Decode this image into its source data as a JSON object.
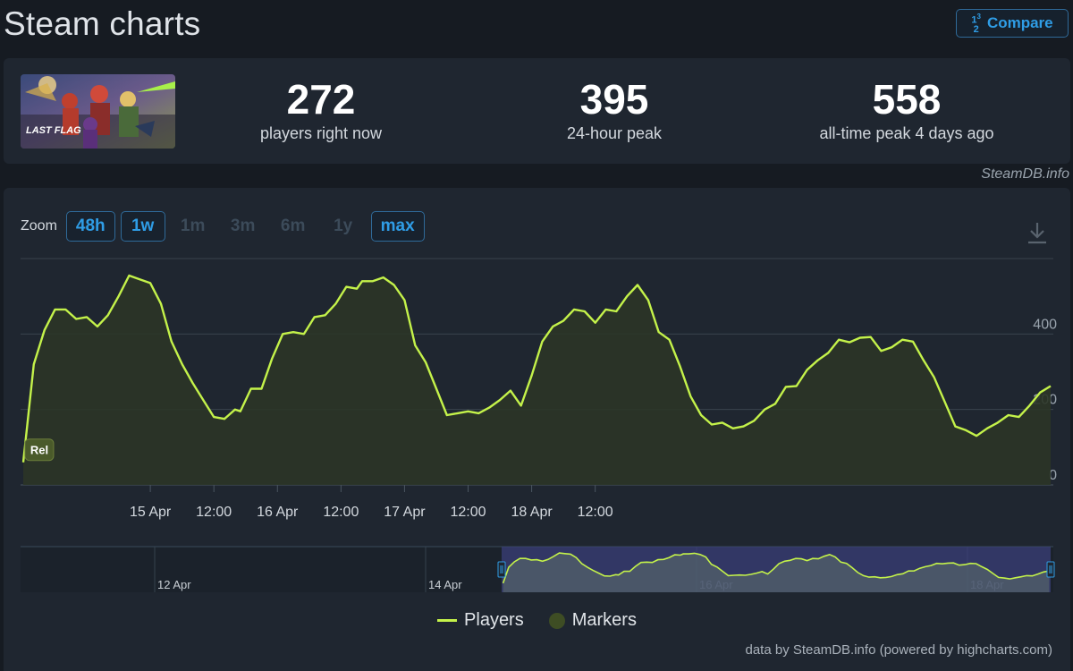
{
  "header": {
    "title": "Steam charts",
    "compare_label": "Compare",
    "compare_icon": "1/2 3"
  },
  "game": {
    "logo_text": "LAST FLAG"
  },
  "stats": [
    {
      "value": "272",
      "label": "players right now"
    },
    {
      "value": "395",
      "label": "24-hour peak"
    },
    {
      "value": "558",
      "label": "all-time peak 4 days ago"
    }
  ],
  "source": "SteamDB.info",
  "zoom": {
    "label": "Zoom",
    "options": [
      {
        "label": "48h",
        "active": true
      },
      {
        "label": "1w",
        "active": true
      },
      {
        "label": "1m",
        "active": false
      },
      {
        "label": "3m",
        "active": false
      },
      {
        "label": "6m",
        "active": false
      },
      {
        "label": "1y",
        "active": false
      },
      {
        "label": "max",
        "active": true
      }
    ]
  },
  "legend": {
    "players": "Players",
    "markers": "Markers"
  },
  "credits": "data by SteamDB.info (powered by highcharts.com)",
  "colors": {
    "line": "#c4f24a",
    "accent": "#2f9de6",
    "background": "#161b22",
    "card": "#1f2630"
  },
  "chart_data": {
    "type": "area",
    "series": [
      {
        "name": "Players",
        "points": [
          [
            0,
            60
          ],
          [
            2,
            320
          ],
          [
            4,
            410
          ],
          [
            6,
            465
          ],
          [
            8,
            465
          ],
          [
            10,
            440
          ],
          [
            12,
            445
          ],
          [
            14,
            420
          ],
          [
            16,
            450
          ],
          [
            18,
            500
          ],
          [
            20,
            555
          ],
          [
            22,
            545
          ],
          [
            24,
            535
          ],
          [
            26,
            480
          ],
          [
            28,
            380
          ],
          [
            30,
            320
          ],
          [
            32,
            270
          ],
          [
            34,
            225
          ],
          [
            36,
            180
          ],
          [
            38,
            175
          ],
          [
            40,
            200
          ],
          [
            41,
            195
          ],
          [
            43,
            255
          ],
          [
            45,
            255
          ],
          [
            47,
            335
          ],
          [
            49,
            400
          ],
          [
            51,
            405
          ],
          [
            53,
            400
          ],
          [
            55,
            445
          ],
          [
            57,
            450
          ],
          [
            59,
            480
          ],
          [
            61,
            525
          ],
          [
            63,
            520
          ],
          [
            64,
            540
          ],
          [
            66,
            540
          ],
          [
            68,
            550
          ],
          [
            70,
            530
          ],
          [
            72,
            490
          ],
          [
            74,
            370
          ],
          [
            76,
            325
          ],
          [
            78,
            255
          ],
          [
            80,
            185
          ],
          [
            82,
            190
          ],
          [
            84,
            195
          ],
          [
            86,
            190
          ],
          [
            88,
            205
          ],
          [
            90,
            225
          ],
          [
            92,
            250
          ],
          [
            94,
            210
          ],
          [
            96,
            290
          ],
          [
            98,
            380
          ],
          [
            100,
            420
          ],
          [
            102,
            435
          ],
          [
            104,
            465
          ],
          [
            106,
            460
          ],
          [
            108,
            430
          ],
          [
            110,
            465
          ],
          [
            112,
            460
          ],
          [
            114,
            500
          ],
          [
            116,
            530
          ],
          [
            118,
            490
          ],
          [
            120,
            405
          ],
          [
            122,
            385
          ],
          [
            124,
            315
          ],
          [
            126,
            235
          ],
          [
            128,
            185
          ],
          [
            130,
            160
          ],
          [
            132,
            165
          ],
          [
            134,
            150
          ],
          [
            136,
            155
          ],
          [
            138,
            170
          ],
          [
            140,
            200
          ],
          [
            142,
            215
          ],
          [
            144,
            260
          ],
          [
            146,
            262
          ],
          [
            148,
            305
          ],
          [
            150,
            330
          ],
          [
            152,
            350
          ],
          [
            154,
            385
          ],
          [
            156,
            378
          ],
          [
            158,
            390
          ],
          [
            160,
            392
          ],
          [
            162,
            355
          ],
          [
            164,
            365
          ],
          [
            166,
            385
          ],
          [
            168,
            380
          ],
          [
            170,
            330
          ],
          [
            172,
            285
          ],
          [
            174,
            220
          ],
          [
            176,
            155
          ],
          [
            178,
            145
          ],
          [
            180,
            130
          ],
          [
            182,
            150
          ],
          [
            184,
            165
          ],
          [
            186,
            185
          ],
          [
            188,
            180
          ],
          [
            190,
            210
          ],
          [
            192,
            245
          ],
          [
            194,
            262
          ]
        ]
      }
    ],
    "x_unit": "hours since 14 Apr 00:00",
    "xlim": [
      -0.5,
      194.5
    ],
    "ylim": [
      0,
      600
    ],
    "y_ticks": [
      0,
      200,
      400
    ],
    "x_ticks": [
      {
        "hour": 24,
        "label": "15 Apr"
      },
      {
        "hour": 36,
        "label": "12:00"
      },
      {
        "hour": 48,
        "label": "16 Apr"
      },
      {
        "hour": 60,
        "label": "12:00"
      },
      {
        "hour": 72,
        "label": "17 Apr"
      },
      {
        "hour": 84,
        "label": "12:00"
      },
      {
        "hour": 96,
        "label": "18 Apr"
      },
      {
        "hour": 108,
        "label": "12:00"
      }
    ],
    "grid": true,
    "markers": [
      {
        "hour": 0,
        "value": 60,
        "label": "Rel"
      }
    ],
    "navigator": {
      "tick_labels": [
        "12 Apr",
        "14 Apr",
        "16 Apr",
        "18 Apr"
      ],
      "range": [
        "14 Apr",
        "18 Apr"
      ]
    }
  }
}
